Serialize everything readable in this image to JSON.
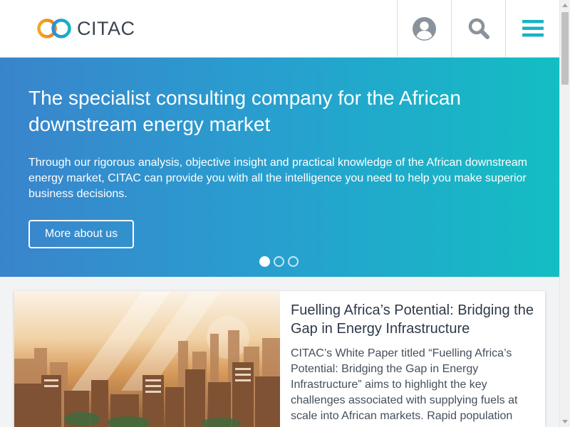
{
  "header": {
    "logo_text": "CITAC",
    "logo_icon": "infinity-rings-logo",
    "user_icon": "user-icon",
    "search_icon": "search-icon",
    "menu_icon": "hamburger-menu-icon"
  },
  "hero": {
    "title": "The specialist consulting company for the African downstream energy market",
    "text": "Through our rigorous analysis, objective insight and practical knowledge of the African downstream energy market, CITAC can provide you with all the intelligence you need to help you make superior business decisions.",
    "button_label": "More about us",
    "slides": [
      {
        "active": true
      },
      {
        "active": false
      },
      {
        "active": false
      }
    ]
  },
  "card": {
    "title": "Fuelling Africa’s Potential: Bridging the Gap in Energy Infrastructure",
    "text": "CITAC’s White Paper titled “Fuelling Africa’s Potential: Bridging the Gap in Energy Infrastructure” aims to highlight the key challenges associated with supplying fuels at scale into African markets. Rapid population"
  },
  "colors": {
    "accent_teal": "#17b3c4",
    "hero_gradient_start": "#3a84cc",
    "hero_gradient_end": "#13bec2",
    "icon_gray": "#8a939c",
    "title_text": "#2d3a48"
  }
}
